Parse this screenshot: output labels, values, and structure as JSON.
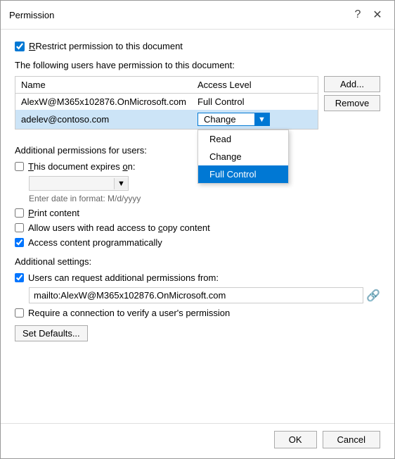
{
  "dialog": {
    "title": "Permission",
    "help_btn": "?",
    "close_btn": "✕"
  },
  "restrict_checkbox": {
    "label": "Restrict permission to this document",
    "checked": true
  },
  "users_section": {
    "label": "The following users have permission to this document:",
    "columns": [
      "Name",
      "Access Level"
    ],
    "rows": [
      {
        "name": "AlexW@M365x102876.OnMicrosoft.com",
        "access": "Full Control",
        "selected": false
      },
      {
        "name": "adelev@contoso.com",
        "access": "Change",
        "selected": true
      }
    ],
    "add_btn": "Add...",
    "remove_btn": "Remove"
  },
  "dropdown": {
    "options": [
      "Read",
      "Change",
      "Full Control"
    ],
    "selected": "Full Control"
  },
  "additional_perms": {
    "title": "Additional permissions for users:",
    "expires_label": "This document expires on:",
    "expires_checked": false,
    "date_placeholder": "Enter date in format: M/d/yyyy",
    "print_label": "Print content",
    "print_checked": false,
    "copy_label": "Allow users with read access to copy content",
    "copy_checked": false,
    "programmatic_label": "Access content programmatically",
    "programmatic_checked": true
  },
  "additional_settings": {
    "title": "Additional settings:",
    "request_label": "Users can request additional permissions from:",
    "request_checked": true,
    "email_value": "mailto:AlexW@M365x102876.OnMicrosoft.com",
    "require_label": "Require a connection to verify a user's permission",
    "require_checked": false
  },
  "set_defaults_btn": "Set Defaults...",
  "footer": {
    "ok_btn": "OK",
    "cancel_btn": "Cancel"
  }
}
